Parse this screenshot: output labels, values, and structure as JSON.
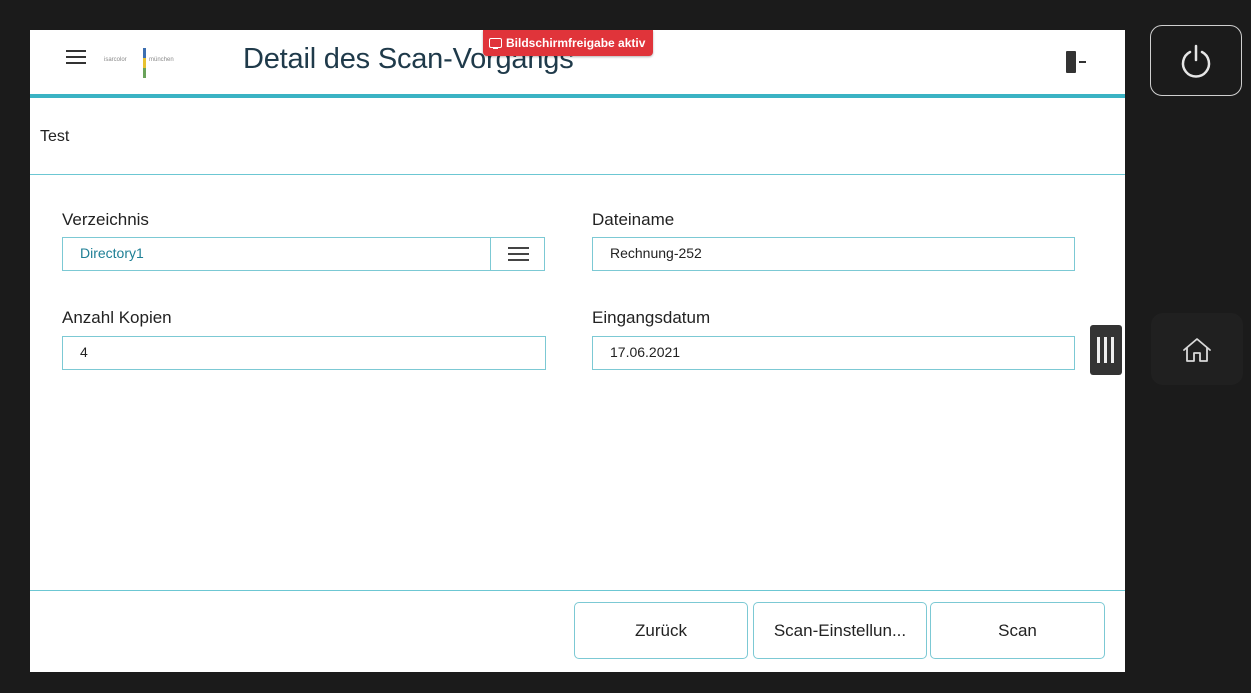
{
  "header": {
    "title": "Detail des Scan-Vorgangs",
    "share_badge": "Bildschirmfreigabe aktiv",
    "logo_left": "isarcolor",
    "logo_right": "münchen"
  },
  "subheader": {
    "text": "Test"
  },
  "form": {
    "directory": {
      "label": "Verzeichnis",
      "value": "Directory1"
    },
    "filename": {
      "label": "Dateiname",
      "value": "Rechnung-252"
    },
    "copies": {
      "label": "Anzahl Kopien",
      "value": "4"
    },
    "date": {
      "label": "Eingangsdatum",
      "value": "17.06.2021"
    }
  },
  "footer": {
    "back_label": "Zurück",
    "settings_label": "Scan-Einstellun...",
    "scan_label": "Scan"
  },
  "colors": {
    "accent": "#3ab3c4",
    "badge": "#e0343a"
  },
  "icons": [
    "menu-icon",
    "exit-icon",
    "list-icon",
    "power-icon",
    "home-icon",
    "screen-share-icon"
  ]
}
